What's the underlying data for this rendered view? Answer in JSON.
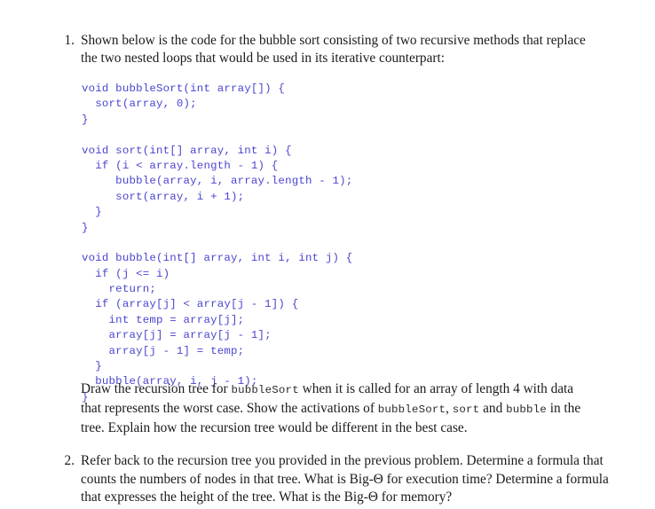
{
  "document": {
    "type": "homework-problem-set",
    "background_color": "#ffffff",
    "text_color": "#1a1a1a",
    "code_color": "#4a45cf",
    "inline_code_color": "#2b2b2b"
  },
  "questions": [
    {
      "number": "1.",
      "intro": "Shown below is the code for the bubble sort consisting of two recursive methods that replace the two nested loops that would be used in its iterative counterpart:"
    },
    {
      "number": "2.",
      "text": "Refer back to the recursion tree you provided in the previous problem. Determine a formula that counts the numbers of nodes in that tree. What is Big-Θ for execution time? Determine a formula that expresses the height of the tree. What is the Big-Θ for memory?"
    }
  ],
  "code": {
    "language": "java",
    "lines": [
      "void bubbleSort(int array[]) {",
      "  sort(array, 0);",
      "}",
      "",
      "void sort(int[] array, int i) {",
      "  if (i < array.length - 1) {",
      "     bubble(array, i, array.length - 1);",
      "     sort(array, i + 1);",
      "  }",
      "}",
      "",
      "void bubble(int[] array, int i, int j) {",
      "  if (j <= i)",
      "    return;",
      "  if (array[j] < array[j - 1]) {",
      "    int temp = array[j];",
      "    array[j] = array[j - 1];",
      "    array[j - 1] = temp;",
      "  }",
      "  bubble(array, i, j - 1);",
      "}"
    ]
  },
  "draw_paragraph": {
    "seg_1": "Draw the recursion tree for ",
    "code_1": "bubbleSort",
    "seg_2": " when it is called for an array of length 4 with data that represents the worst case. Show the activations of ",
    "code_2": "bubbleSort",
    "seg_3": ", ",
    "code_3": "sort",
    "seg_4": " and ",
    "code_4": "bubble",
    "seg_5": " in the tree. Explain how the recursion tree would be different in the best case."
  }
}
